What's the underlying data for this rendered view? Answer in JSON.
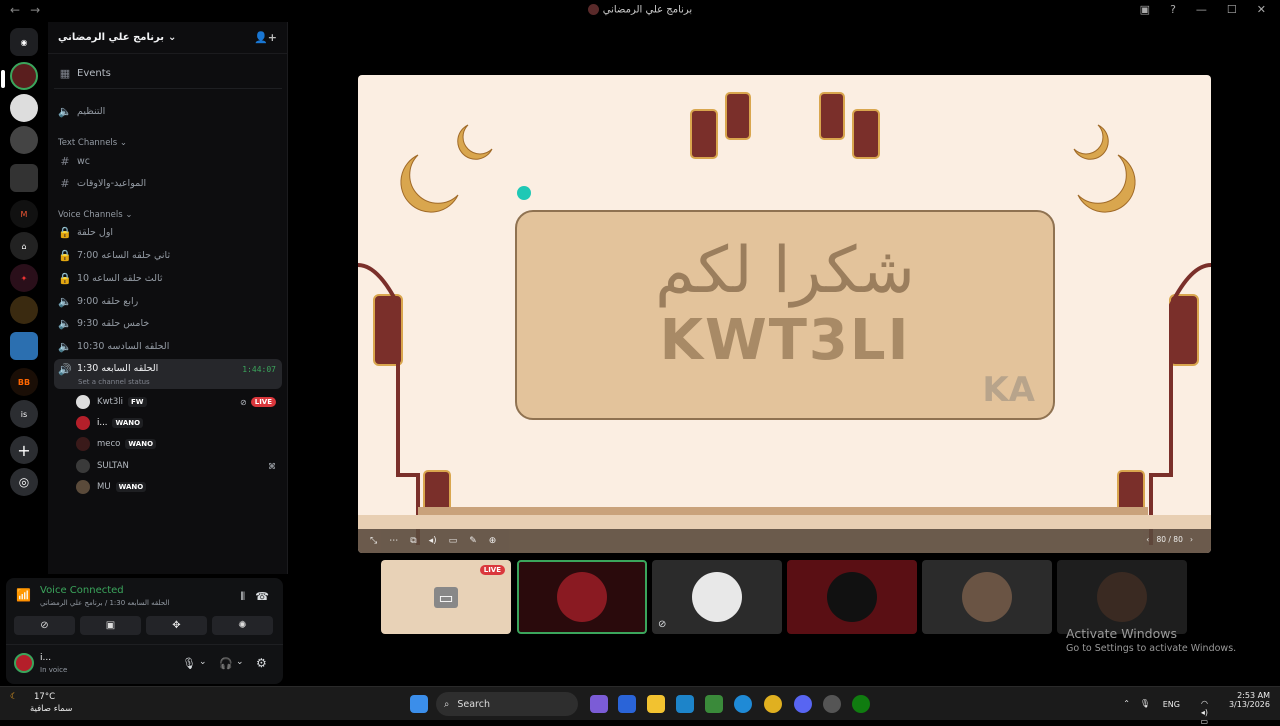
{
  "window": {
    "title": "برنامج علي الرمضاني"
  },
  "server": {
    "name": "برنامج علي الرمضاني",
    "events_label": "Events",
    "top_voice": "التنظيم",
    "text_category": "Text Channels",
    "text_channels": [
      "wc",
      "المواعيد-والاوقات"
    ],
    "voice_category": "Voice Channels",
    "voice_channels": [
      "اول حلقة",
      "ثاني حلقه الساعه 7:00",
      "ثالث حلقه الساعه 10",
      "رابع حلقه 9:00",
      "خامس حلقه 9:30",
      "الحلقه السادسه 10:30"
    ],
    "active_channel": {
      "name": "الحلقه السابعه 1:30",
      "timer": "1:44:07",
      "status": "Set a channel status"
    },
    "members": [
      {
        "name": "Kwt3li",
        "tag": "FW",
        "live": "LIVE"
      },
      {
        "name": "i...",
        "tag": "WANO"
      },
      {
        "name": "meco",
        "tag": "WANO"
      },
      {
        "name": "SULTAN"
      },
      {
        "name": "MU",
        "tag": "WANO"
      }
    ]
  },
  "voice_panel": {
    "status": "Voice Connected",
    "channel_path": "الحلقه السابعه 1:30 / برنامج علي الرمضاني",
    "user_name": "i...",
    "user_status": "In voice"
  },
  "stream": {
    "arabic_text": "شكرا لكم",
    "english_text": "KWT3LI",
    "logo": "KA",
    "page_counter": "80 / 80"
  },
  "thumbnails": {
    "live_label": "LIVE"
  },
  "activate": {
    "title": "Activate Windows",
    "subtitle": "Go to Settings to activate Windows."
  },
  "taskbar": {
    "weather_temp": "17°C",
    "weather_desc": "سماء صافية",
    "search_placeholder": "Search",
    "lang": "ENG",
    "time": "2:53 AM",
    "date": "3/13/2026"
  },
  "colors": {
    "accent_green": "#3ba55c",
    "live_red": "#da373c",
    "stream_bg": "#fbeee2",
    "card": "#e3c39b"
  }
}
